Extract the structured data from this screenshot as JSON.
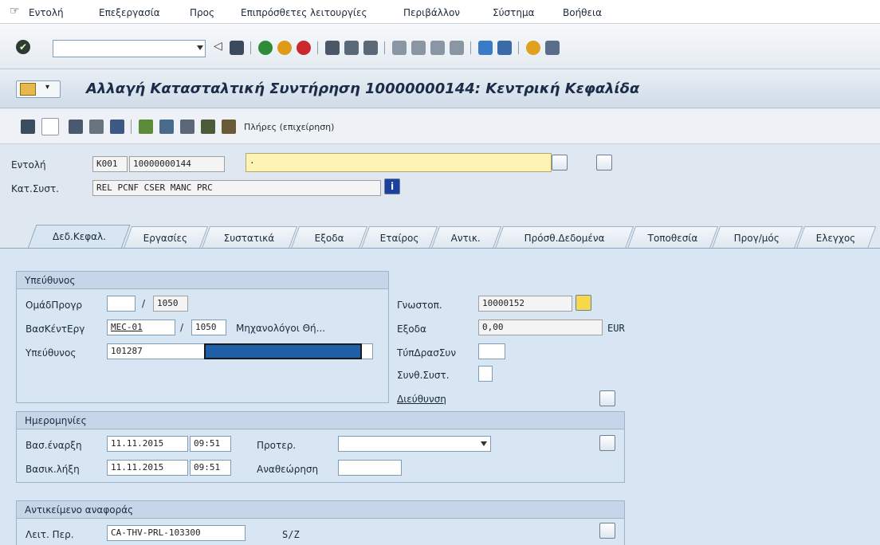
{
  "menu": {
    "items": [
      "Εντολή",
      "Επεξεργασία",
      "Προς",
      "Επιπρόσθετες λειτουργίες",
      "Περιβάλλον",
      "Σύστημα",
      "Βοήθεια"
    ]
  },
  "toolbar": {
    "command_field_value": ""
  },
  "title": "Αλλαγή Κατασταλτική Συντήρηση 10000000144: Κεντρική Κεφαλίδα",
  "app_toolbar": {
    "full_label": "Πλήρες (επιχείρηση)"
  },
  "header": {
    "order_label": "Εντολή",
    "order_type": "K001",
    "order_number": "10000000144",
    "order_text": ".",
    "status_label": "Κατ.Συστ.",
    "status_value": "REL  PCNF CSER MANC PRC"
  },
  "tabs": [
    "Δεδ.Κεφαλ.",
    "Εργασίες",
    "Συστατικά",
    "Εξοδα",
    "Εταίρος",
    "Αντικ.",
    "Πρόσθ.Δεδομένα",
    "Τοποθεσία",
    "Προγ/μός",
    "Ελεγχος"
  ],
  "responsible": {
    "title": "Υπεύθυνος",
    "planner_group_label": "ΟμάδΠρογρ",
    "planner_group_value": "",
    "planner_group_plant": "1050",
    "work_center_label": "ΒασΚέντΕργ",
    "work_center_value": "MEC-01",
    "work_center_plant": "1050",
    "work_center_desc": "Μηχανολόγοι Θή...",
    "person_label": "Υπεύθυνος",
    "person_value": "101287",
    "notification_label": "Γνωστοπ.",
    "notification_value": "10000152",
    "costs_label": "Εξοδα",
    "costs_value": "0,00",
    "currency": "EUR",
    "activity_type_label": "ΤύπΔρασΣυν",
    "system_cond_label": "Συνθ.Συστ.",
    "address_label": "Διεύθυνση"
  },
  "dates": {
    "title": "Ημερομηνίες",
    "basic_start_label": "Βασ.έναρξη",
    "basic_start_date": "11.11.2015",
    "basic_start_time": "09:51",
    "basic_end_label": "Βασικ.λήξη",
    "basic_end_date": "11.11.2015",
    "basic_end_time": "09:51",
    "priority_label": "Προτερ.",
    "revision_label": "Αναθεώρηση"
  },
  "reference_object": {
    "title": "Αντικείμενο αναφοράς",
    "func_loc_label": "Λειτ. Περ.",
    "func_loc_value": "CA-THV-PRL-103300",
    "sz_label": "S/Z"
  },
  "colors": {
    "masked_bar": "#1f5fa8",
    "accent_title": "#1a2c47"
  }
}
